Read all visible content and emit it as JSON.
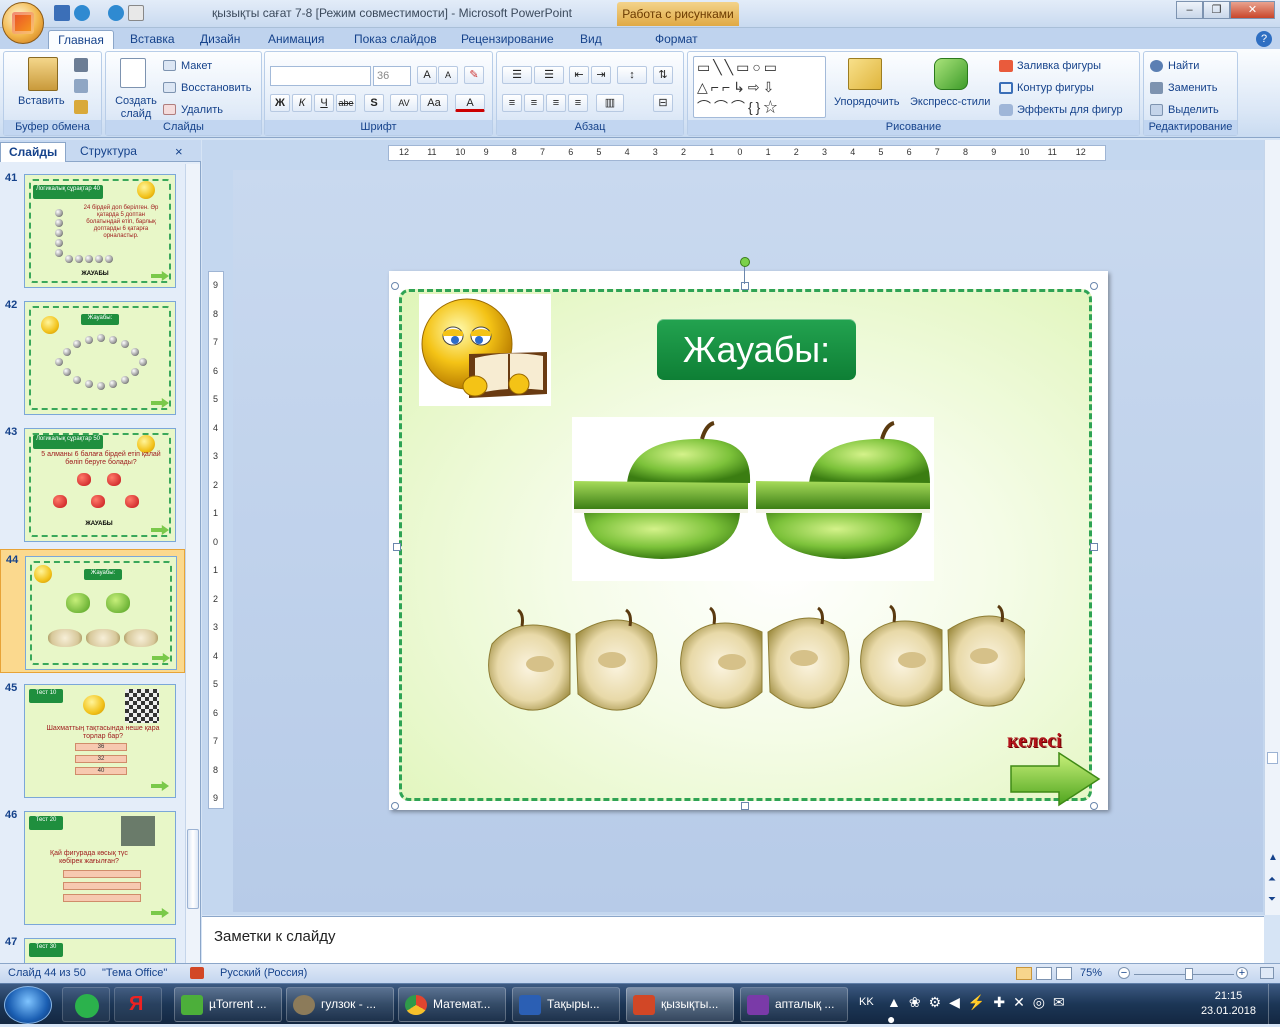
{
  "window": {
    "title": "қызықты сағат 7-8 [Режим совместимости] - Microsoft PowerPoint",
    "context_tab_group": "Работа с рисунками",
    "minimize": "–",
    "maximize": "❐",
    "close": "✕"
  },
  "ribbon_tabs": [
    "Главная",
    "Вставка",
    "Дизайн",
    "Анимация",
    "Показ слайдов",
    "Рецензирование",
    "Вид",
    "Формат"
  ],
  "ribbon": {
    "clipboard": {
      "paste": "Вставить",
      "label": "Буфер обмена"
    },
    "slides": {
      "new_slide": "Создать слайд",
      "layout": "Макет",
      "reset": "Восстановить",
      "delete": "Удалить",
      "label": "Слайды"
    },
    "font": {
      "font_size": "36",
      "label": "Шрифт",
      "bold": "Ж",
      "italic": "К",
      "underline": "Ч",
      "strike": "abe",
      "shadow": "S",
      "spacing": "AV",
      "case": "Aa",
      "color": "A",
      "grow": "A",
      "shrink": "A"
    },
    "paragraph": {
      "label": "Абзац"
    },
    "drawing": {
      "arrange": "Упорядочить",
      "quick_styles": "Экспресс-стили",
      "fill": "Заливка фигуры",
      "outline": "Контур фигуры",
      "effects": "Эффекты для фигур",
      "label": "Рисование"
    },
    "editing": {
      "find": "Найти",
      "replace": "Заменить",
      "select": "Выделить",
      "label": "Редактирование"
    }
  },
  "slides_pane": {
    "tab_slides": "Слайды",
    "tab_outline": "Структура",
    "close": "×",
    "thumbnails": [
      {
        "num": "41",
        "label": "Логикалық сұрақтар 40",
        "text": "24 бірдей доп берілген. Әр қатарда 5 доптан болатындай етіп, барлық доптарды 6 қатарға орналастыр.",
        "answer": "ЖАУАБЫ",
        "selected": false
      },
      {
        "num": "42",
        "label": "Жауабы:",
        "text": "",
        "answer": "",
        "selected": false
      },
      {
        "num": "43",
        "label": "Логикалық сұрақтар 50",
        "text": "5 алманы 6 балаға бірдей етіп қалай бөліп беруге болады?",
        "answer": "ЖАУАБЫ",
        "selected": false
      },
      {
        "num": "44",
        "label": "Жауабы:",
        "text": "",
        "answer": "",
        "selected": true
      },
      {
        "num": "45",
        "label": "Тест 10",
        "text": "Шахматтың тақтасында неше қара торлар бар?",
        "options": [
          "36",
          "32",
          "40"
        ],
        "selected": false
      },
      {
        "num": "46",
        "label": "Тест 20",
        "text": "Қай фигурада көсық түс көбірек жағылған?",
        "options": [
          "",
          "",
          ""
        ],
        "selected": false
      },
      {
        "num": "47",
        "label": "Тест 30",
        "text": "",
        "selected": false
      }
    ]
  },
  "slide": {
    "answer_label": "Жауабы:",
    "next_label": "келесі"
  },
  "ruler": {
    "h_ticks": [
      "12",
      "11",
      "10",
      "9",
      "8",
      "7",
      "6",
      "5",
      "4",
      "3",
      "2",
      "1",
      "0",
      "1",
      "2",
      "3",
      "4",
      "5",
      "6",
      "7",
      "8",
      "9",
      "10",
      "11",
      "12"
    ],
    "v_ticks": [
      "9",
      "8",
      "7",
      "6",
      "5",
      "4",
      "3",
      "2",
      "1",
      "0",
      "1",
      "2",
      "3",
      "4",
      "5",
      "6",
      "7",
      "8",
      "9"
    ]
  },
  "notes": {
    "placeholder": "Заметки к слайду"
  },
  "status": {
    "slide_pos": "Слайд 44 из 50",
    "theme": "\"Тема Office\"",
    "language": "Русский (Россия)",
    "zoom": "75%",
    "zoom_level": 0.55
  },
  "taskbar": {
    "apps": [
      {
        "label": "µTorrent ...",
        "color": "#4caf3a"
      },
      {
        "label": "гулзок - ...",
        "color": "#8c7b5a"
      },
      {
        "label": "Математ...",
        "color": "#e0452f"
      },
      {
        "label": "Тақыры...",
        "color": "#2b5fb4"
      },
      {
        "label": "қызықты...",
        "color": "#d24726"
      },
      {
        "label": "апталық ...",
        "color": "#7a3aa8"
      }
    ],
    "lang": "KK",
    "time": "21:15",
    "date": "23.01.2018"
  }
}
